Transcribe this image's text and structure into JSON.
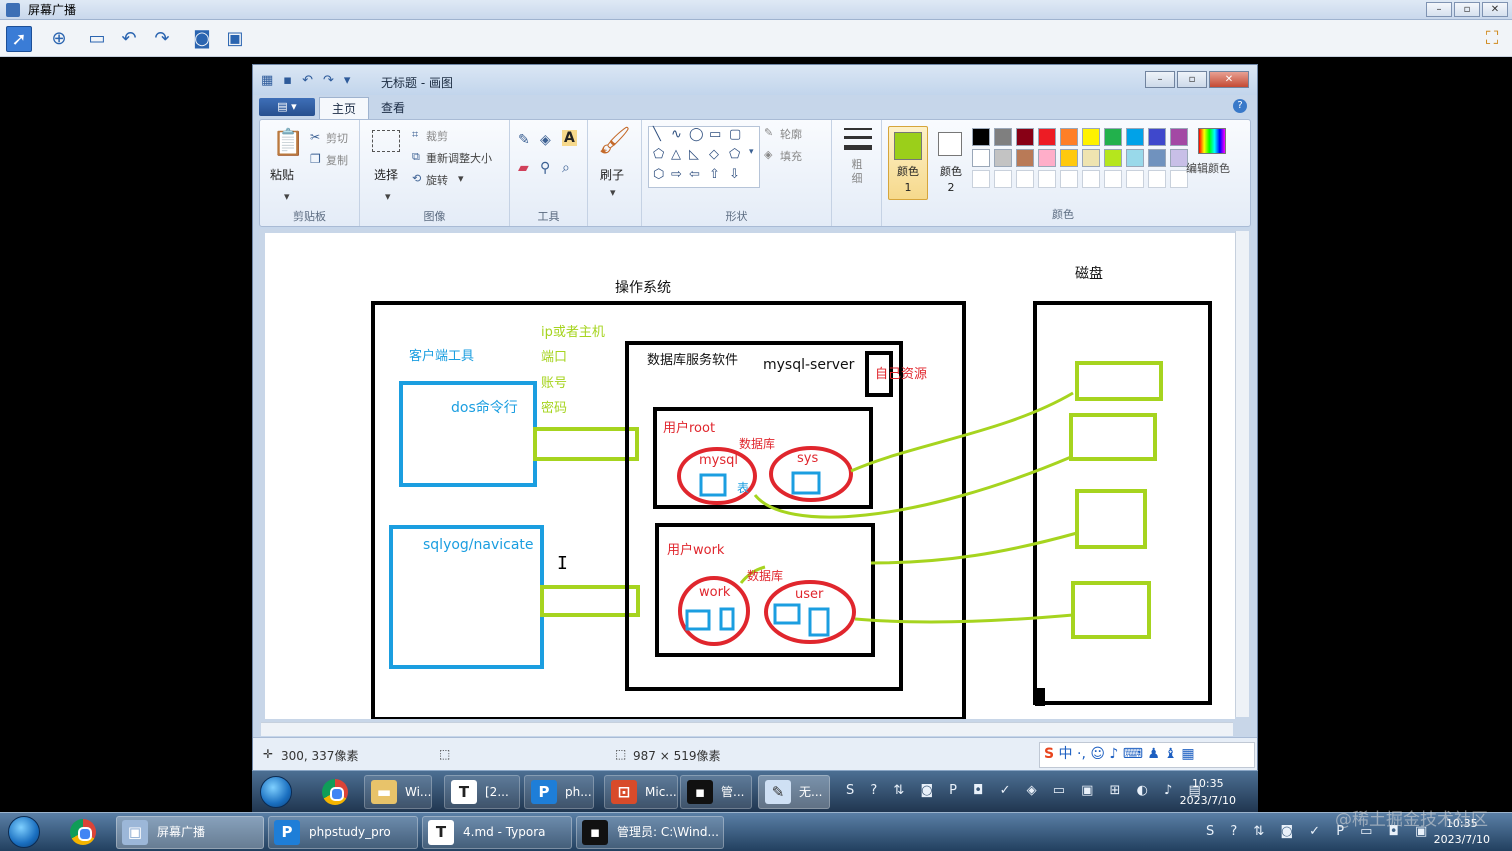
{
  "broadcast": {
    "title": "屏幕广播",
    "toolbar_icons": [
      "pointer-icon",
      "zoom-icon",
      "screen-icon",
      "undo-icon",
      "redo-icon",
      "camera-icon",
      "monitor-icon"
    ]
  },
  "paint": {
    "title": "无标题 - 画图",
    "tabs": [
      "主页",
      "查看"
    ],
    "ribbon": {
      "clipboard": {
        "paste": "粘贴",
        "cut": "剪切",
        "copy": "复制",
        "label": "剪贴板"
      },
      "image": {
        "select": "选择",
        "crop": "裁剪",
        "resize": "重新调整大小",
        "rotate": "旋转",
        "label": "图像"
      },
      "tools": {
        "label": "工具"
      },
      "brush": {
        "label": "刷子"
      },
      "shapes": {
        "outline": "轮廓",
        "fill": "填充",
        "label": "形状"
      },
      "size": {
        "label": "粗细"
      },
      "color1": "颜色 1",
      "color2": "颜色 2",
      "colors": {
        "label": "颜色",
        "edit": "编辑颜色"
      },
      "palette_row1": [
        "#000000",
        "#7f7f7f",
        "#880015",
        "#ed1c24",
        "#ff7f27",
        "#fff200",
        "#22b14c",
        "#00a2e8",
        "#3f48cc",
        "#a349a4"
      ],
      "palette_row2": [
        "#ffffff",
        "#c3c3c3",
        "#b97a57",
        "#ffaec9",
        "#ffc90e",
        "#efe4b0",
        "#b5e61d",
        "#99d9ea",
        "#7092be",
        "#c8bfe7"
      ],
      "color1_value": "#9bcf1a",
      "color2_value": "#ffffff"
    },
    "canvas": {
      "os_label": "操作系统",
      "disk_label": "磁盘",
      "client_tools": "客户端工具",
      "conn_info": [
        "ip或者主机",
        "端口",
        "账号",
        "密码"
      ],
      "dos": "dos命令行",
      "sqlyog": "sqlyog/navicate",
      "db_software": "数据库服务软件",
      "mysql_server": "mysql-server",
      "own_resource": "自己资源",
      "user_root": "用户root",
      "database1": "数据库",
      "mysql": "mysql",
      "sys": "sys",
      "table": "表",
      "user_work": "用户work",
      "database2": "数据库",
      "work": "work",
      "user": "user"
    },
    "status": {
      "cursor": "300, 337像素",
      "size": "987 × 519像素"
    }
  },
  "inner_taskbar": {
    "items": [
      "Wi...",
      "[2...",
      "ph...",
      "Mic...",
      "管...",
      "无..."
    ],
    "time": "10:35",
    "date": "2023/7/10"
  },
  "outer_taskbar": {
    "items": [
      "屏幕广播",
      "phpstudy_pro",
      "4.md - Typora",
      "管理员: C:\\Wind..."
    ],
    "time": "10:35",
    "date": "2023/7/10"
  },
  "watermark": "@稀土掘金技术社区"
}
